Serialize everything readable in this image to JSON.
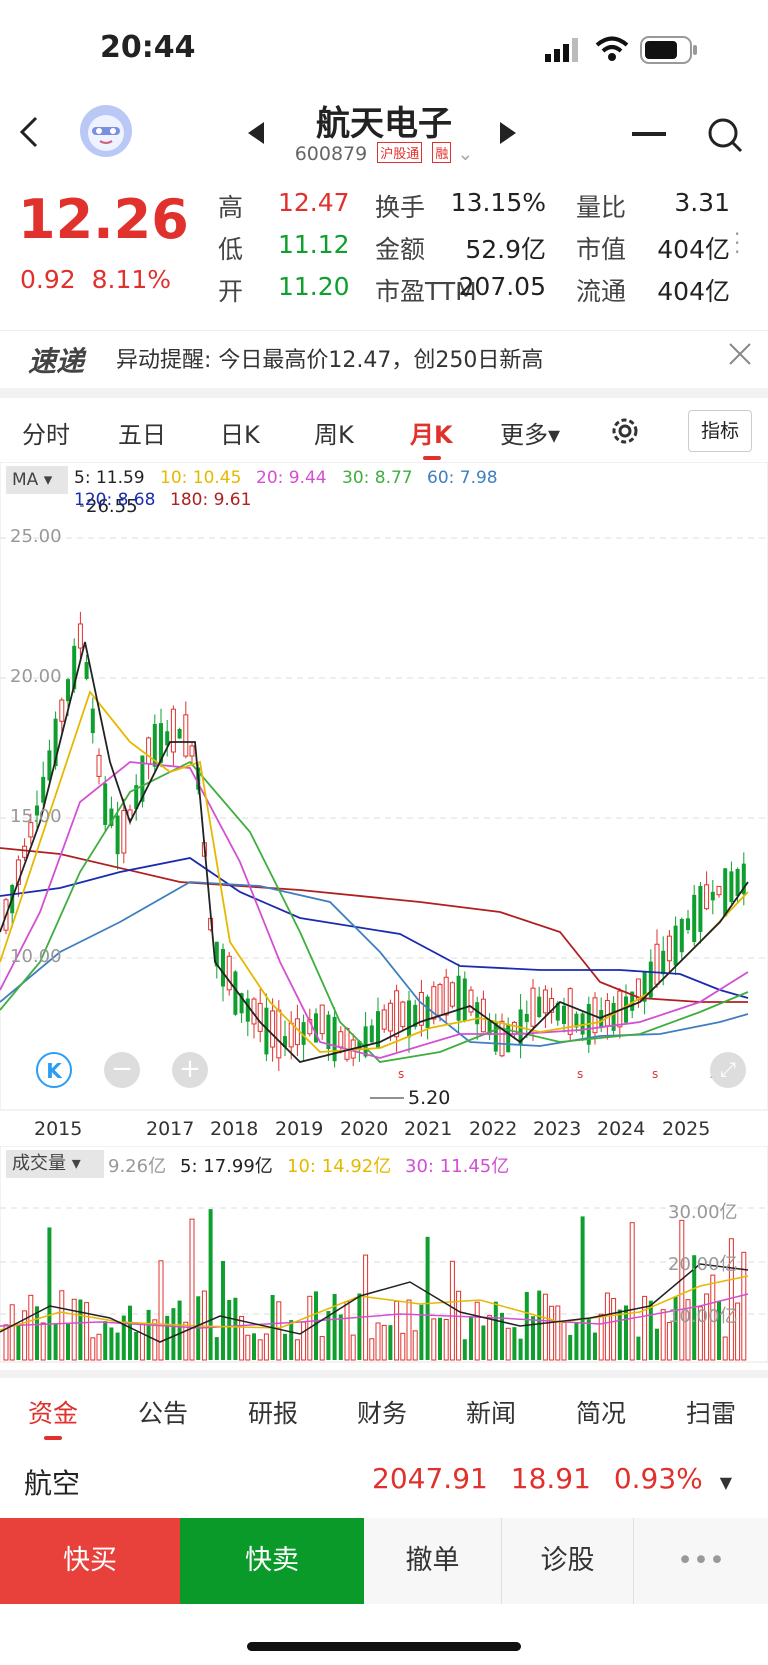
{
  "status_bar": {
    "time": "20:44"
  },
  "header": {
    "title": "航天电子",
    "code": "600879",
    "tag_hgt": "沪股通",
    "tag_rong": "融"
  },
  "quote": {
    "price": "12.26",
    "change": "0.92",
    "change_pct": "8.11%",
    "rows": [
      [
        {
          "label": "高",
          "value": "12.47",
          "color": "red"
        },
        {
          "label": "换手",
          "value": "13.15%"
        },
        {
          "label": "量比",
          "value": "3.31"
        }
      ],
      [
        {
          "label": "低",
          "value": "11.12",
          "color": "green"
        },
        {
          "label": "金额",
          "value": "52.9亿"
        },
        {
          "label": "市值",
          "value": "404亿"
        }
      ],
      [
        {
          "label": "开",
          "value": "11.20",
          "color": "green"
        },
        {
          "label": "市盈TTM",
          "value": "207.05"
        },
        {
          "label": "流通",
          "value": "404亿"
        }
      ]
    ]
  },
  "alert": {
    "logo": "速递",
    "text": "异动提醒: 今日最高价12.47，创250日新高"
  },
  "tabs": [
    "分时",
    "五日",
    "日K",
    "周K",
    "月K",
    "更多▾"
  ],
  "active_tab": "月K",
  "indicator_button": "指标",
  "ma_legend": {
    "button": "MA",
    "items": [
      {
        "text": "5: 11.59",
        "color": "#222222"
      },
      {
        "text": "10: 10.45",
        "color": "#e6b800"
      },
      {
        "text": "20: 9.44",
        "color": "#d34fd3"
      },
      {
        "text": "30: 8.77",
        "color": "#3fae3f"
      },
      {
        "text": "60: 7.98",
        "color": "#3f7fc0"
      },
      {
        "text": "120: 8.68",
        "color": "#1a2bb0"
      },
      {
        "text": "180: 9.61",
        "color": "#b02020"
      }
    ],
    "high_marker": "26.55",
    "low_marker": "5.20"
  },
  "y_axis": [
    "25.00",
    "20.00",
    "15.00",
    "10.00"
  ],
  "x_axis": [
    "2015",
    "2017",
    "2018",
    "2019",
    "2020",
    "2021",
    "2022",
    "2023",
    "2024",
    "2025"
  ],
  "volume": {
    "button": "成交量",
    "value": "9.26亿",
    "items": [
      {
        "text": "5: 17.99亿",
        "color": "#222222"
      },
      {
        "text": "10: 14.92亿",
        "color": "#e6b800"
      },
      {
        "text": "30: 11.45亿",
        "color": "#d34fd3"
      }
    ],
    "y_axis": [
      "30.00亿",
      "20.00亿",
      "10.00亿"
    ]
  },
  "bottom_tabs": [
    "资金",
    "公告",
    "研报",
    "财务",
    "新闻",
    "简况",
    "扫雷"
  ],
  "sector": {
    "name": "航空",
    "value": "2047.91",
    "change": "18.91",
    "change_pct": "0.93%"
  },
  "actions": {
    "buy": "快买",
    "sell": "快卖",
    "cancel": "撤单",
    "diagnose": "诊股",
    "more": "•••"
  },
  "colors": {
    "up": "#e0312d",
    "down": "#0e9f2f"
  }
}
